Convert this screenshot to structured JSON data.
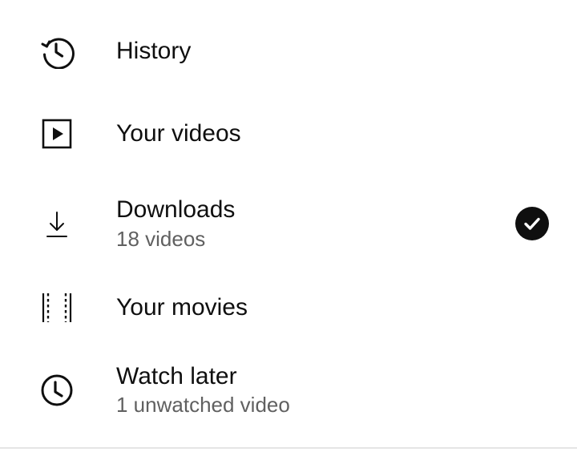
{
  "menu": {
    "items": [
      {
        "label": "History",
        "icon": "history-icon"
      },
      {
        "label": "Your videos",
        "icon": "play-box-icon"
      },
      {
        "label": "Downloads",
        "sublabel": "18 videos",
        "icon": "download-icon",
        "status_icon": "check-circle-icon"
      },
      {
        "label": "Your movies",
        "icon": "film-strip-icon"
      },
      {
        "label": "Watch later",
        "sublabel": "1 unwatched video",
        "icon": "clock-icon"
      }
    ]
  },
  "colors": {
    "text": "#0f0f0f",
    "secondary_text": "#606060",
    "divider": "#e5e5e5",
    "background": "#ffffff"
  }
}
